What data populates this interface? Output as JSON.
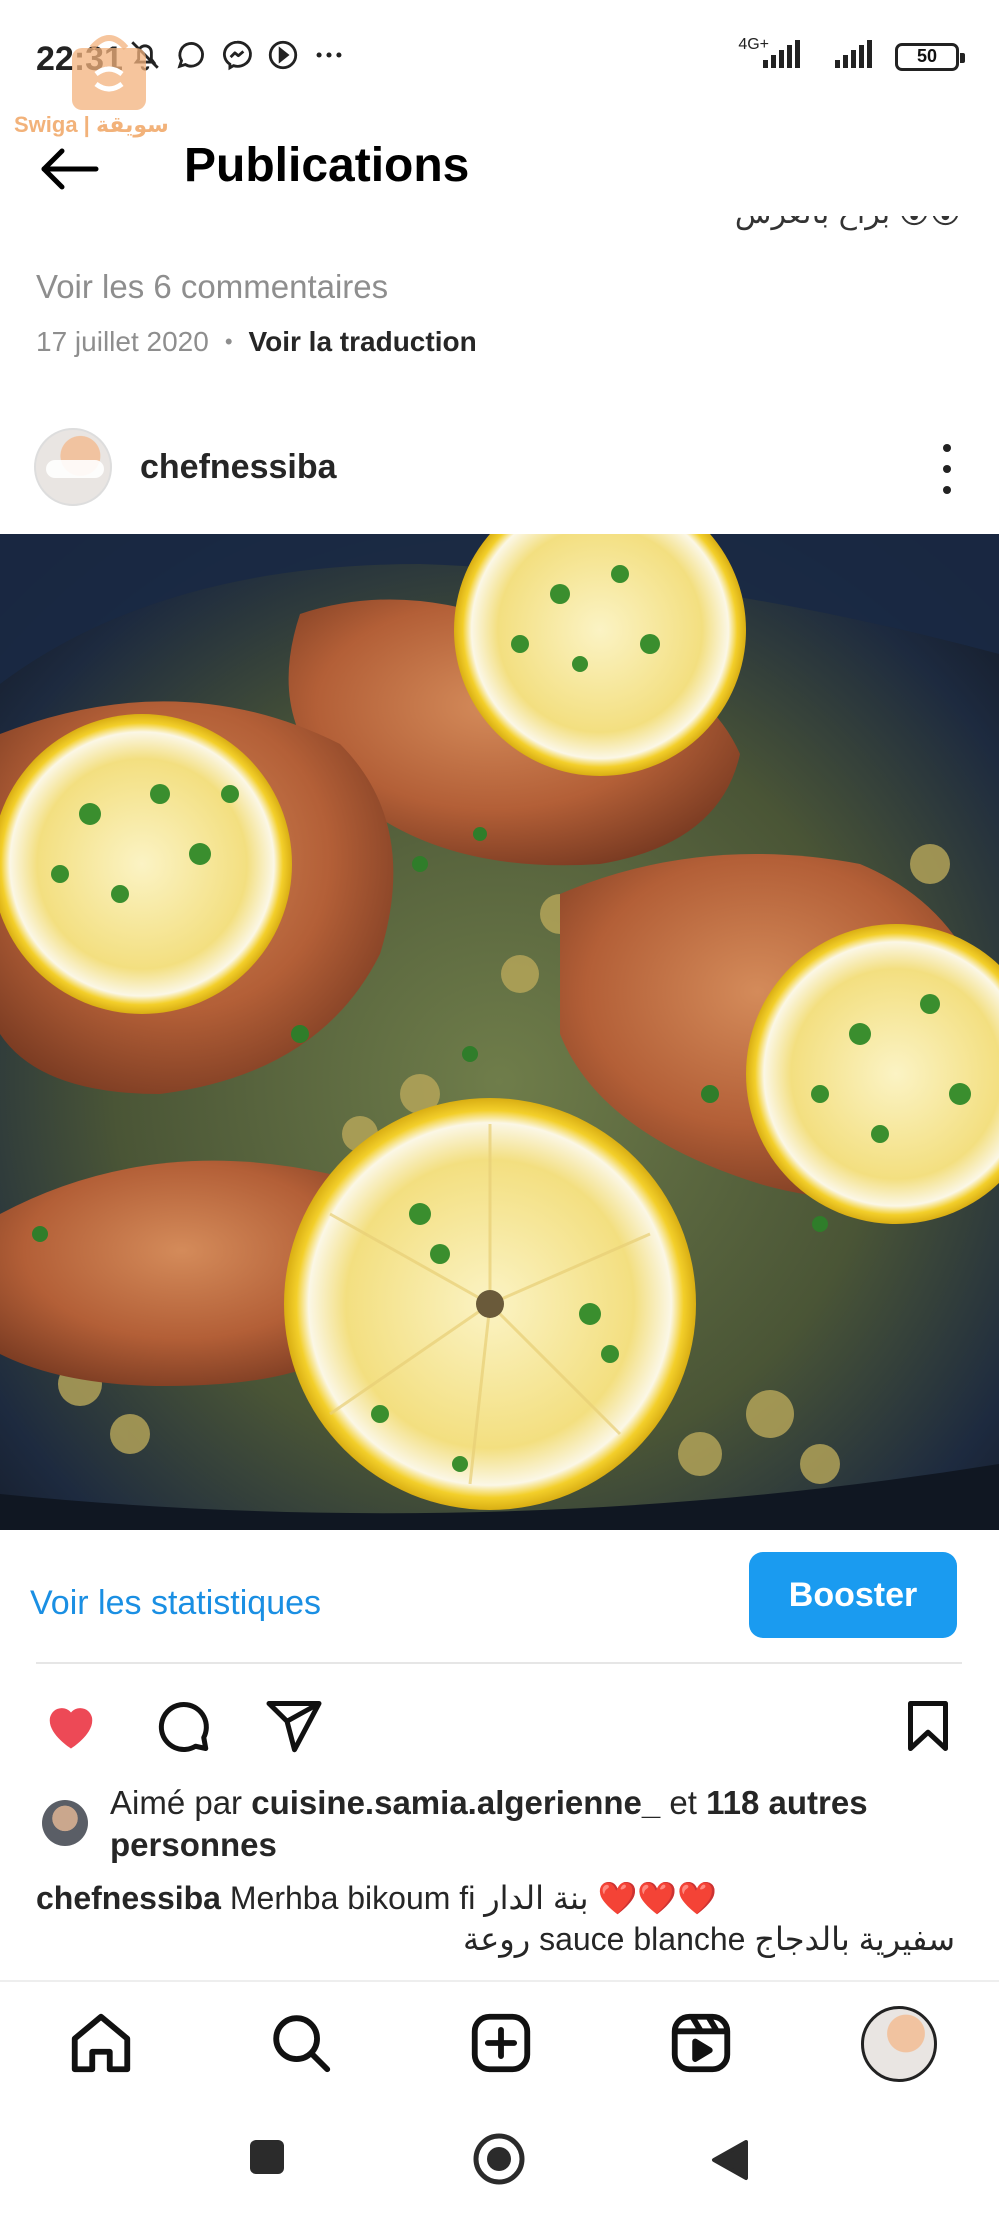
{
  "status_bar": {
    "time": "22:31",
    "network_label": "4G+",
    "battery": "50",
    "left_icons": [
      "mute-bell-icon",
      "whatsapp-icon",
      "messenger-icon",
      "navigation-icon",
      "more-dots-icon"
    ]
  },
  "watermark": {
    "text": "Swiga | سويقة"
  },
  "header": {
    "title": "Publications"
  },
  "prev_post": {
    "caption_fragment": "براح بالعرس 😮😮",
    "view_comments": "Voir les 6 commentaires",
    "date": "17 juillet 2020",
    "translate": "Voir la traduction"
  },
  "post": {
    "username": "chefnessiba",
    "stats_link": "Voir les statistiques",
    "boost_label": "Booster",
    "likes_prefix": "Aimé par ",
    "likes_user": "cuisine.samia.algerienne_",
    "likes_mid": " et ",
    "likes_others": "118 autres personnes",
    "caption_user": "chefnessiba",
    "caption_text": " Merhba bikoum fi بنة الدار ❤️❤️❤️",
    "caption_line2": "سفيرية بالدجاج sauce blanche روعة"
  },
  "colors": {
    "accent_blue": "#1a9bf0",
    "link_blue": "#1a8fe3",
    "like_red": "#ed4956"
  }
}
